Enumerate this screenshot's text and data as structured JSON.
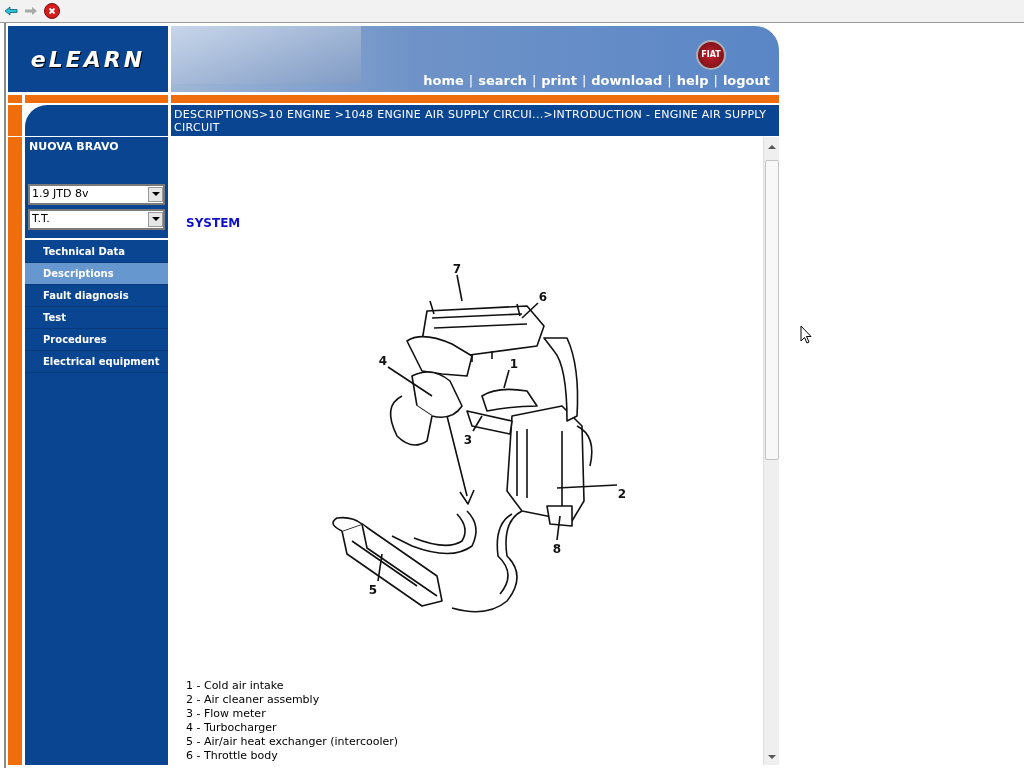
{
  "header": {
    "logo": "eLEARN",
    "brand_badge": "FIAT",
    "nav": [
      {
        "kind": "link",
        "text": "home"
      },
      {
        "kind": "separator",
        "text": "|"
      },
      {
        "kind": "link",
        "text": "search"
      },
      {
        "kind": "separator",
        "text": "|"
      },
      {
        "kind": "link",
        "text": "print"
      },
      {
        "kind": "separator",
        "text": "|"
      },
      {
        "kind": "link",
        "text": "download"
      },
      {
        "kind": "separator",
        "text": "|"
      },
      {
        "kind": "link",
        "text": "help"
      },
      {
        "kind": "separator",
        "text": "|"
      },
      {
        "kind": "link",
        "text": "logout"
      }
    ]
  },
  "breadcrumb": "DESCRIPTIONS>10 ENGINE >1048 ENGINE AIR SUPPLY CIRCUI...>INTRODUCTION - ENGINE AIR SUPPLY CIRCUIT",
  "sidebar": {
    "model": "NUOVA BRAVO",
    "dropdowns": [
      "1.9 JTD 8v",
      "T.T."
    ],
    "items": [
      {
        "label": "Technical Data",
        "selected": false
      },
      {
        "label": "Descriptions",
        "selected": true
      },
      {
        "label": "Fault diagnosis",
        "selected": false
      },
      {
        "label": "Test",
        "selected": false
      },
      {
        "label": "Procedures",
        "selected": false
      },
      {
        "label": "Electrical equipment",
        "selected": false
      }
    ]
  },
  "content": {
    "heading": "SYSTEM",
    "diagram": {
      "callouts": [
        "7",
        "6",
        "1",
        "4",
        "3",
        "2",
        "8",
        "5"
      ]
    },
    "legend": [
      "1 - Cold air intake",
      "2 - Air cleaner assembly",
      "3 - Flow meter",
      "4 - Turbocharger",
      "5 - Air/air heat exchanger (intercooler)",
      "6 - Throttle body"
    ]
  }
}
